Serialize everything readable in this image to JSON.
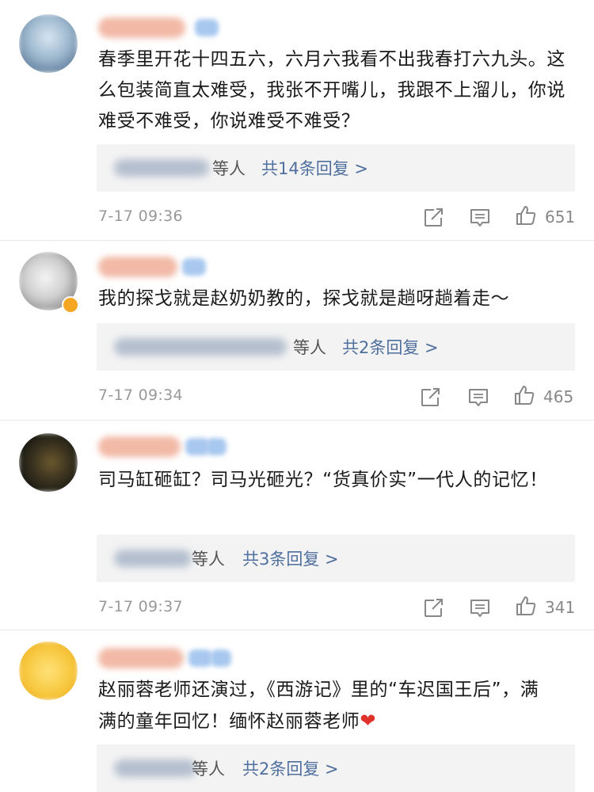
{
  "comments": [
    {
      "text": "春季里开花十四五六，六月六我看不出我春打六九头。这么包装简直太难受，我张不开嘴儿，我跟不上溜儿，你说难受不难受，你说难受不难受？",
      "reply_suffix": "等人",
      "reply_count": "共14条回复 >",
      "time": "7-17 09:36",
      "likes": "651"
    },
    {
      "text": "我的探戈就是赵奶奶教的，探戈就是趟呀趟着走～",
      "reply_suffix": "等人",
      "reply_count": "共2条回复 >",
      "time": "7-17 09:34",
      "likes": "465"
    },
    {
      "text": "司马缸砸缸？司马光砸光？“货真价实”一代人的记忆！",
      "reply_suffix": "等人",
      "reply_count": "共3条回复 >",
      "time": "7-17 09:37",
      "likes": "341"
    },
    {
      "text": "赵丽蓉老师还演过，《西游记》里的“车迟国王后”，满满的童年回忆！缅怀赵丽蓉老师",
      "heart": "❤",
      "reply_suffix": "等人",
      "reply_count": "共2条回复 >"
    }
  ],
  "icons": [
    "share-icon",
    "comment-icon",
    "like-icon"
  ],
  "colors": {
    "link": "#4f6f9e",
    "reply_bg": "#f3f3f3",
    "meta": "#999999",
    "heart": "#e0302a"
  }
}
